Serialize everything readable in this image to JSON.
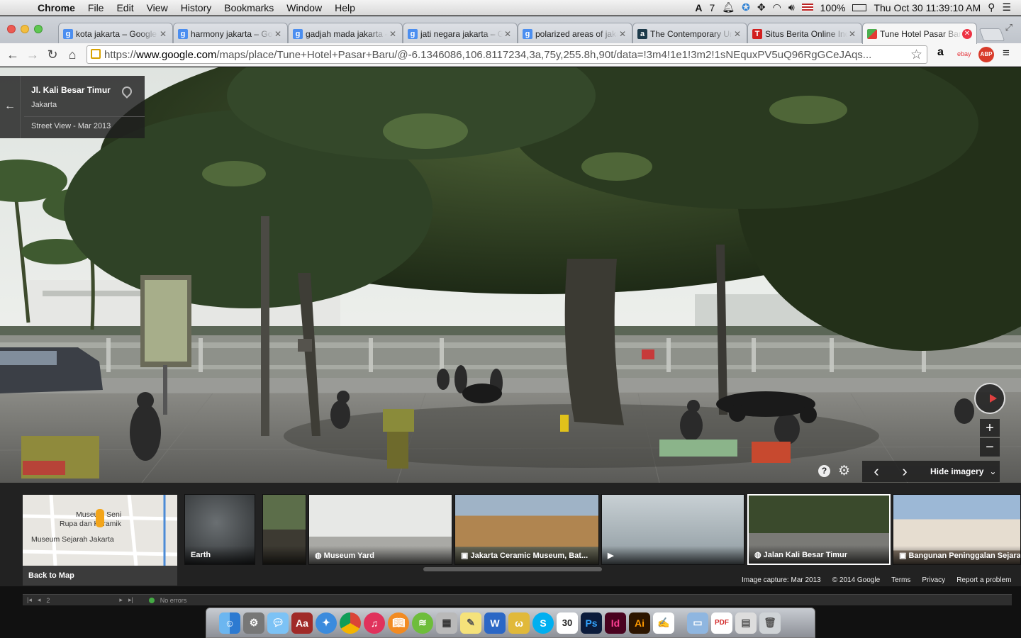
{
  "menubar": {
    "app": "Chrome",
    "items": [
      "File",
      "Edit",
      "View",
      "History",
      "Bookmarks",
      "Window",
      "Help"
    ],
    "adobe_count": "7",
    "battery": "100%",
    "clock": "Thu Oct 30  11:39:10 AM"
  },
  "tabs": [
    {
      "title": "kota jakarta – Google Search",
      "icon": "g"
    },
    {
      "title": "harmony jakarta – Google Search",
      "icon": "g"
    },
    {
      "title": "gadjah mada jakarta – Google",
      "icon": "g"
    },
    {
      "title": "jati negara jakarta – Google",
      "icon": "g"
    },
    {
      "title": "polarized areas of jakarta",
      "icon": "g"
    },
    {
      "title": "The Contemporary Urban",
      "icon": "a"
    },
    {
      "title": "Situs Berita Online Indonesia",
      "icon": "T"
    },
    {
      "title": "Tune Hotel Pasar Baru",
      "icon": "maps",
      "active": true
    }
  ],
  "toolbar": {
    "url_scheme": "https://",
    "url_host": "www.google.com",
    "url_path": "/maps/place/Tune+Hotel+Pasar+Baru/@-6.1346086,106.8117234,3a,75y,255.8h,90t/data=!3m4!1e1!3m2!1sNEquxPV5uQ96RgGCeJAqs...",
    "ext_amazon": "a",
    "ext_ebay": "ebay",
    "ext_abp": "ABP"
  },
  "location_card": {
    "street": "Jl. Kali Besar Timur",
    "city": "Jakarta",
    "date": "Street View - Mar 2013"
  },
  "streetview_controls": {
    "zoom_in": "+",
    "zoom_out": "−",
    "help": "?",
    "prev": "‹",
    "next": "›",
    "hide_imagery": "Hide imagery"
  },
  "filmstrip": {
    "map": {
      "labels": [
        "Museum Seni",
        "Rupa dan Keramik",
        "Museum Sejarah Jakarta"
      ],
      "back": "Back to Map"
    },
    "thumbs": [
      {
        "caption": "Earth"
      },
      {
        "caption": ""
      },
      {
        "caption": "Museum Yard"
      },
      {
        "caption": "Jakarta Ceramic Museum, Bat..."
      },
      {
        "caption": ""
      },
      {
        "caption": "Jalan Kali Besar Timur",
        "selected": true
      },
      {
        "caption": "Bangunan Peninggalan Sejarah"
      }
    ]
  },
  "footer": {
    "capture": "Image capture: Mar 2013",
    "copyright": "© 2014 Google",
    "terms": "Terms",
    "privacy": "Privacy",
    "report": "Report a problem"
  },
  "bottom_strip": {
    "page": "2",
    "status": "No errors"
  },
  "dock": {
    "calendar_day": "30",
    "apps": [
      "Finder",
      "System Preferences",
      "Messages",
      "Dictionary",
      "Safari",
      "Chrome",
      "iTunes",
      "iBooks",
      "Spotify",
      "Calculator",
      "Stickies",
      "Word",
      "Wunderlist",
      "Skype",
      "Calendar",
      "Photoshop",
      "InDesign",
      "Illustrator",
      "Acrobat",
      "Documents",
      "PDF",
      "Preview",
      "Trash"
    ],
    "ps": "Ps",
    "id": "Id",
    "ai": "Ai"
  },
  "colors": {
    "sky": "#f2f3f0",
    "foliage": "#2c3a22",
    "pavement": "#6d6d6a",
    "water": "#4f5b4a"
  }
}
